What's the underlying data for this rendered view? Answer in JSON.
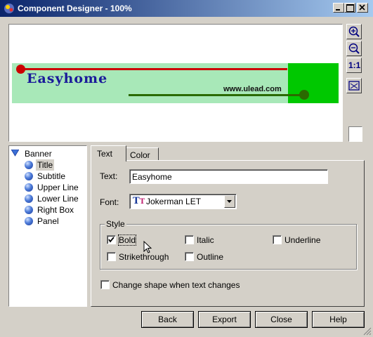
{
  "window": {
    "title": "Component Designer - 100%"
  },
  "preview": {
    "banner_title": "Easyhome",
    "banner_subtitle": "www.ulead.com",
    "colors": {
      "panel": "#a8e8b8",
      "right_box": "#00c800",
      "upper_line": "#cc0000",
      "lower_line": "#2a6a00"
    }
  },
  "tools": {
    "zoom_in": "zoom-in-icon",
    "zoom_out": "zoom-out-icon",
    "actual_size_label": "1:1",
    "fit": "fit-window-icon"
  },
  "tree": {
    "root": "Banner",
    "items": [
      "Title",
      "Subtitle",
      "Upper Line",
      "Lower Line",
      "Right Box",
      "Panel"
    ],
    "selected": "Title"
  },
  "tabs": {
    "text": "Text",
    "color": "Color",
    "active": "Text"
  },
  "text_tab": {
    "text_label": "Text:",
    "text_value": "Easyhome",
    "font_label": "Font:",
    "font_value": "Jokerman LET",
    "style_group": "Style",
    "styles": {
      "bold": {
        "label": "Bold",
        "checked": true
      },
      "italic": {
        "label": "Italic",
        "checked": false
      },
      "underline": {
        "label": "Underline",
        "checked": false
      },
      "strikethrough": {
        "label": "Strikethrough",
        "checked": false
      },
      "outline": {
        "label": "Outline",
        "checked": false
      }
    },
    "change_shape_label": "Change shape when text changes",
    "change_shape_checked": false
  },
  "buttons": {
    "back": "Back",
    "export": "Export",
    "close": "Close",
    "help": "Help"
  }
}
